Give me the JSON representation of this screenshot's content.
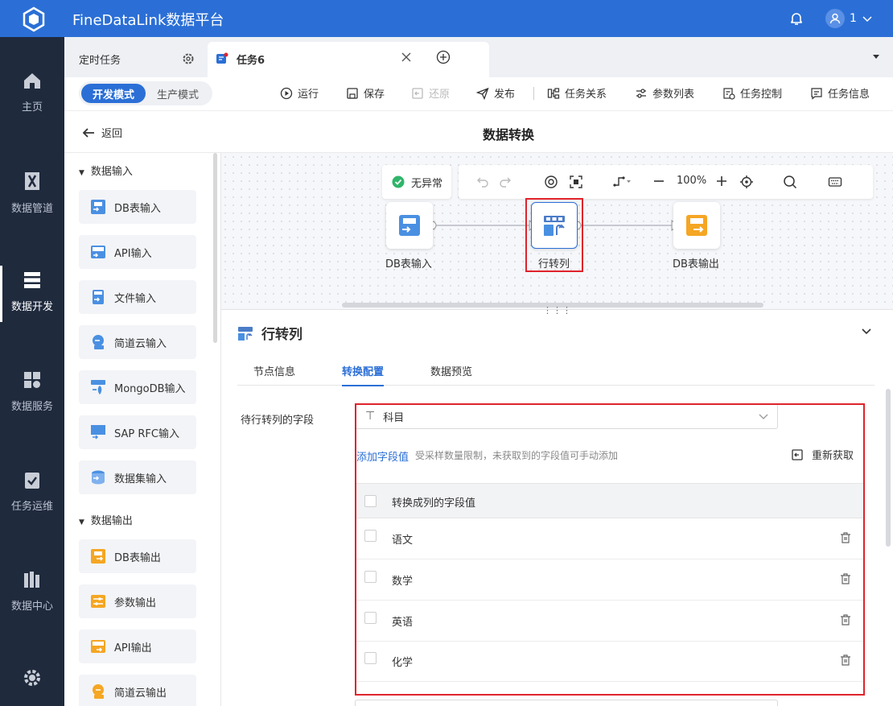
{
  "app": {
    "title": "FineDataLink数据平台",
    "user": "1"
  },
  "nav": {
    "items": [
      "主页",
      "数据管道",
      "数据开发",
      "数据服务",
      "任务运维",
      "数据中心"
    ]
  },
  "tabs": {
    "scheduled": "定时任务",
    "current": "任务6"
  },
  "toolbar": {
    "dev_mode": "开发模式",
    "prod_mode": "生产模式",
    "run": "运行",
    "save": "保存",
    "restore": "还原",
    "publish": "发布",
    "relations": "任务关系",
    "params": "参数列表",
    "control": "任务控制",
    "info": "任务信息"
  },
  "header": {
    "back": "返回",
    "title": "数据转换"
  },
  "palette": {
    "input_group": "数据输入",
    "inputs": [
      {
        "label": "DB表输入",
        "icon": "db-input-icon"
      },
      {
        "label": "API输入",
        "icon": "api-input-icon"
      },
      {
        "label": "文件输入",
        "icon": "file-input-icon"
      },
      {
        "label": "简道云输入",
        "icon": "jdy-input-icon"
      },
      {
        "label": "MongoDB输入",
        "icon": "mongodb-input-icon"
      },
      {
        "label": "SAP RFC输入",
        "icon": "sap-input-icon"
      },
      {
        "label": "数据集输入",
        "icon": "dataset-input-icon"
      }
    ],
    "output_group": "数据输出",
    "outputs": [
      {
        "label": "DB表输出",
        "icon": "db-output-icon"
      },
      {
        "label": "参数输出",
        "icon": "param-output-icon"
      },
      {
        "label": "API输出",
        "icon": "api-output-icon"
      },
      {
        "label": "简道云输出",
        "icon": "jdy-output-icon"
      }
    ]
  },
  "canvas": {
    "status": "无异常",
    "zoom": "100%",
    "nodes": [
      "DB表输入",
      "行转列",
      "DB表输出"
    ]
  },
  "panel": {
    "title": "行转列",
    "tabs": [
      "节点信息",
      "转换配置",
      "数据预览"
    ],
    "field_label": "待行转列的字段",
    "field_value": "科目",
    "add_link": "添加字段值",
    "add_hint": "受采样数量限制，未获取到的字段值可手动添加",
    "refetch": "重新获取",
    "table_header": "转换成列的字段值",
    "rows": [
      "语文",
      "数学",
      "英语",
      "化学"
    ]
  },
  "colors": {
    "primary": "#2b6fd6",
    "nav_bg": "#1f2a3d",
    "highlight": "#e0232b"
  }
}
